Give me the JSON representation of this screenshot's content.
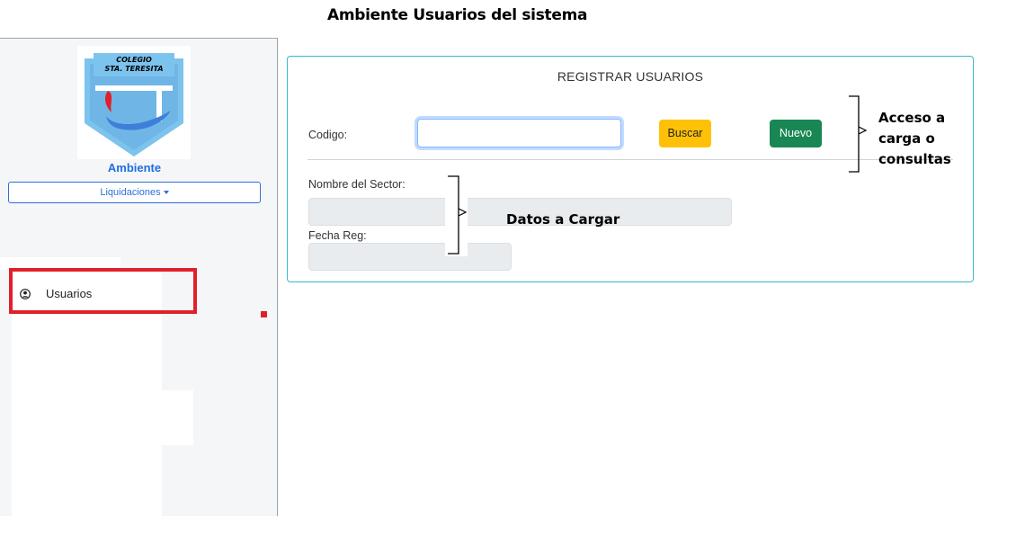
{
  "page_title": "Ambiente Usuarios del sistema",
  "sidebar": {
    "logo_text_line1": "COLEGIO",
    "logo_text_line2": "STA. TERESITA",
    "brand": "Ambiente",
    "dropdown_label": "Liquidaciones",
    "items": [
      {
        "label": "Usuarios",
        "icon": "user-circle-icon"
      }
    ]
  },
  "form": {
    "title": "REGISTRAR USUARIOS",
    "codigo_label": "Codigo:",
    "codigo_value": "",
    "buscar_label": "Buscar",
    "nuevo_label": "Nuevo",
    "nombre_sector_label": "Nombre del Sector:",
    "nombre_sector_value": "",
    "fecha_reg_label": "Fecha Reg:",
    "fecha_reg_value": ""
  },
  "annotations": {
    "acceso_line1": "Acceso a",
    "acceso_line2": "carga o",
    "acceso_line3": "consultas",
    "datos": "Datos a Cargar"
  },
  "colors": {
    "brand_blue": "#1f6fe0",
    "card_border": "#36b9c9",
    "buscar_yellow": "#ffc107",
    "nuevo_green": "#198754",
    "highlight_red": "#e0212b"
  }
}
